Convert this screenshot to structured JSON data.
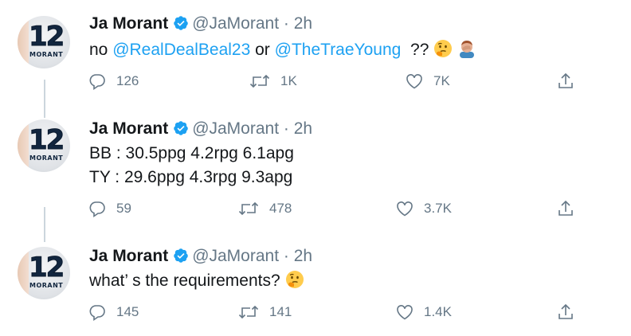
{
  "tweets": [
    {
      "author": {
        "name": "Ja Morant",
        "handle": "@JaMorant",
        "jersey_number": "12",
        "jersey_name": "MORANT"
      },
      "dot": "·",
      "time": "2h",
      "text": {
        "prefix": "no ",
        "mention1": "@RealDealBeal23",
        "middle": " or ",
        "mention2": "@TheTraeYoung",
        "suffix": "  ??"
      },
      "emojis": [
        "thinking-face",
        "man-facepalming"
      ],
      "stats": {
        "replies": "126",
        "retweets": "1K",
        "likes": "7K"
      }
    },
    {
      "author": {
        "name": "Ja Morant",
        "handle": "@JaMorant",
        "jersey_number": "12",
        "jersey_name": "MORANT"
      },
      "dot": "·",
      "time": "2h",
      "lines": [
        "BB : 30.5ppg 4.2rpg 6.1apg",
        "TY : 29.6ppg 4.3rpg 9.3apg"
      ],
      "stats": {
        "replies": "59",
        "retweets": "478",
        "likes": "3.7K"
      }
    },
    {
      "author": {
        "name": "Ja Morant",
        "handle": "@JaMorant",
        "jersey_number": "12",
        "jersey_name": "MORANT"
      },
      "dot": "·",
      "time": "2h",
      "text": "what’ s the requirements?",
      "emojis": [
        "thinking-face"
      ],
      "stats": {
        "replies": "145",
        "retweets": "141",
        "likes": "1.4K"
      }
    }
  ],
  "colors": {
    "accent": "#1da1f2",
    "muted": "#657786",
    "text": "#14171a",
    "thread_line": "#ccd6dd"
  }
}
